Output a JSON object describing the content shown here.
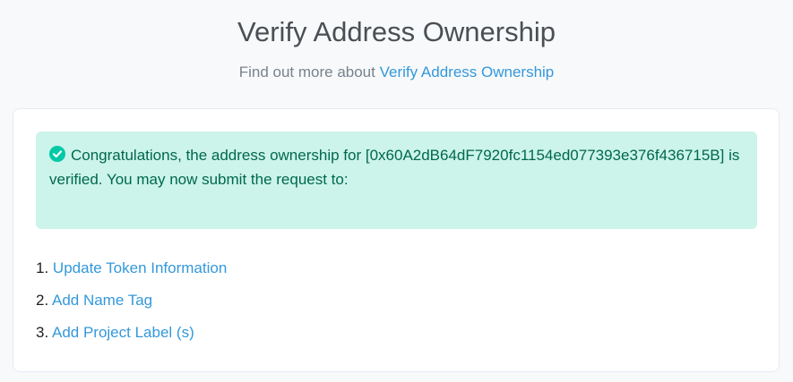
{
  "header": {
    "title": "Verify Address Ownership",
    "subtitle_prefix": "Find out more about",
    "subtitle_link": "Verify Address Ownership"
  },
  "alert": {
    "icon": "check-circle-icon",
    "message": "Congratulations, the address ownership for [0x60A2dB64dF7920fc1154ed077393e376f436715B] is verified. You may now submit the request to:"
  },
  "steps": [
    {
      "number": "1.",
      "label": "Update Token Information"
    },
    {
      "number": "2.",
      "label": "Add Name Tag"
    },
    {
      "number": "3.",
      "label": "Add Project Label (s)"
    }
  ],
  "colors": {
    "link": "#3498db",
    "success_bg": "#ccf4ea",
    "success_text": "#00684c",
    "success_icon": "#00c9a7"
  }
}
